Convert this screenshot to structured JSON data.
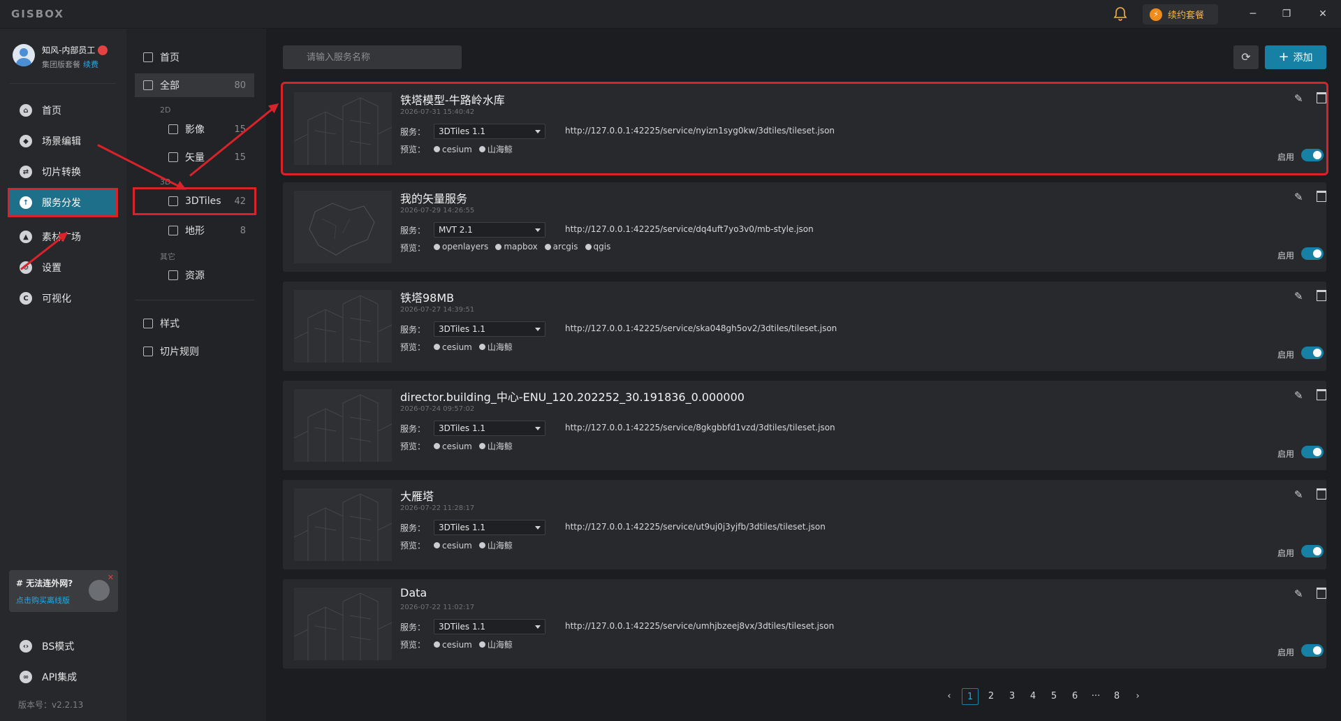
{
  "app": {
    "brand": "GISBOX",
    "renew_label": "续约套餐",
    "version": "版本号：v2.2.13"
  },
  "user": {
    "name": "知风-内部员工",
    "plan": "集团版套餐",
    "renew_link": "续费"
  },
  "nav": {
    "items": [
      {
        "label": "首页",
        "icon": "home-icon"
      },
      {
        "label": "场景编辑",
        "icon": "cube-icon"
      },
      {
        "label": "切片转换",
        "icon": "swap-icon"
      },
      {
        "label": "服务分发",
        "icon": "upload-icon",
        "active": true
      },
      {
        "label": "素材广场",
        "icon": "image-icon"
      },
      {
        "label": "设置",
        "icon": "gear-icon"
      },
      {
        "label": "可视化",
        "icon": "chart-icon"
      }
    ],
    "bottom": [
      {
        "label": "BS模式",
        "icon": "code-icon"
      },
      {
        "label": "API集成",
        "icon": "link-icon"
      }
    ]
  },
  "promo": {
    "title": "# 无法连外网?",
    "link": "点击购买离线版"
  },
  "sub": {
    "home": "首页",
    "all": {
      "label": "全部",
      "count": "80"
    },
    "group_2d": "2D",
    "imagery": {
      "label": "影像",
      "count": "15"
    },
    "vector": {
      "label": "矢量",
      "count": "15"
    },
    "group_3d": "3D",
    "tiles3d": {
      "label": "3DTiles",
      "count": "42"
    },
    "terrain": {
      "label": "地形",
      "count": "8"
    },
    "group_other": "其它",
    "resource": {
      "label": "资源"
    },
    "style": {
      "label": "样式"
    },
    "slice_rules": {
      "label": "切片规则"
    }
  },
  "toolbar": {
    "search_placeholder": "请输入服务名称",
    "add_label": "添加"
  },
  "labels": {
    "service": "服务：",
    "preview": "预览：",
    "enabled": "启用"
  },
  "services": [
    {
      "title": "铁塔模型-牛路岭水库",
      "date": "2026-07-31 15:40:42",
      "type": "3DTiles 1.1",
      "url": "http://127.0.0.1:42225/service/nyizn1syg0kw/3dtiles/tileset.json",
      "previews": [
        "cesium",
        "山海鲸"
      ],
      "enabled": true
    },
    {
      "title": "我的矢量服务",
      "date": "2026-07-29 14:26:55",
      "type": "MVT 2.1",
      "url": "http://127.0.0.1:42225/service/dq4uft7yo3v0/mb-style.json",
      "previews": [
        "openlayers",
        "mapbox",
        "arcgis",
        "qgis"
      ],
      "enabled": true
    },
    {
      "title": "铁塔98MB",
      "date": "2026-07-27 14:39:51",
      "type": "3DTiles 1.1",
      "url": "http://127.0.0.1:42225/service/ska048gh5ov2/3dtiles/tileset.json",
      "previews": [
        "cesium",
        "山海鲸"
      ],
      "enabled": true
    },
    {
      "title": "director.building_中心-ENU_120.202252_30.191836_0.000000",
      "date": "2026-07-24 09:57:02",
      "type": "3DTiles 1.1",
      "url": "http://127.0.0.1:42225/service/8gkgbbfd1vzd/3dtiles/tileset.json",
      "previews": [
        "cesium",
        "山海鲸"
      ],
      "enabled": true
    },
    {
      "title": "大雁塔",
      "date": "2026-07-22 11:28:17",
      "type": "3DTiles 1.1",
      "url": "http://127.0.0.1:42225/service/ut9uj0j3yjfb/3dtiles/tileset.json",
      "previews": [
        "cesium",
        "山海鲸"
      ],
      "enabled": true
    },
    {
      "title": "Data",
      "date": "2026-07-22 11:02:17",
      "type": "3DTiles 1.1",
      "url": "http://127.0.0.1:42225/service/umhjbzeej8vx/3dtiles/tileset.json",
      "previews": [
        "cesium",
        "山海鲸"
      ],
      "enabled": true
    }
  ],
  "pagination": {
    "pages": [
      "1",
      "2",
      "3",
      "4",
      "5",
      "6",
      "···",
      "8"
    ],
    "current": "1",
    "prev": "‹",
    "next": "›"
  }
}
